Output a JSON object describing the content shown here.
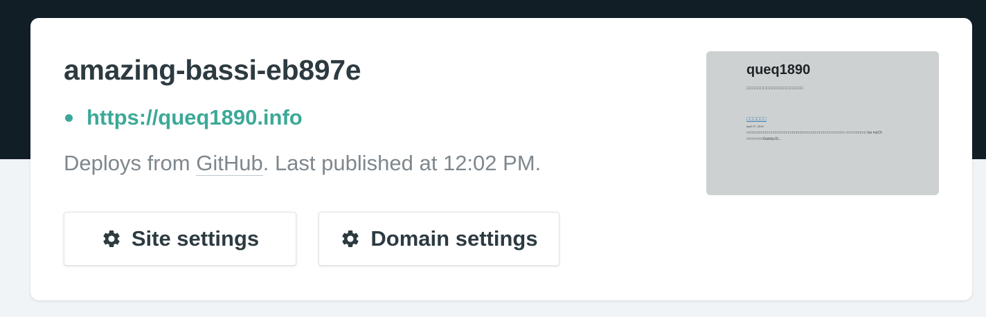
{
  "site": {
    "name": "amazing-bassi-eb897e",
    "url": "https://queq1890.info",
    "deploy_prefix": "Deploys from ",
    "deploy_provider": "GitHub",
    "deploy_suffix": ". Last published at 12:02 PM.",
    "status_color": "#3ca998"
  },
  "buttons": {
    "site_settings": {
      "label": "Site settings",
      "icon": "gear-icon"
    },
    "domain_settings": {
      "label": "Domain settings",
      "icon": "gear-icon"
    }
  },
  "preview": {
    "title": "queq1890",
    "tagline": "□□□□□□□□□□□□□□□□□□□□",
    "post_title": "□□□□□□",
    "post_date": "April 07, 2019",
    "post_excerpt": "□□□□□□□□□□□□□□□□□□□□□□□□□□□□□□□□□□□□□□□□□□□□□□□ □□□□□□□□□□ tss myCh □□□□□□□□GatsbyJS..."
  },
  "colors": {
    "top_band": "#121e26",
    "page_background": "#f1f4f6",
    "accent": "#3ca998",
    "text_primary": "#2d3b41",
    "text_muted": "#7e878d"
  }
}
